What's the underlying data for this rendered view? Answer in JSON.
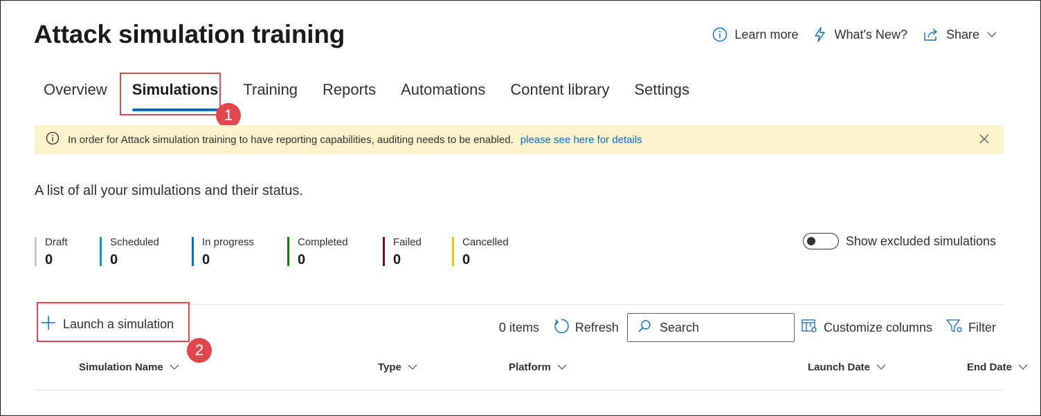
{
  "page": {
    "title": "Attack simulation training"
  },
  "header_actions": {
    "learn_more": "Learn more",
    "whats_new": "What's New?",
    "share": "Share"
  },
  "tabs": [
    {
      "label": "Overview",
      "active": false
    },
    {
      "label": "Simulations",
      "active": true
    },
    {
      "label": "Training",
      "active": false
    },
    {
      "label": "Reports",
      "active": false
    },
    {
      "label": "Automations",
      "active": false
    },
    {
      "label": "Content library",
      "active": false
    },
    {
      "label": "Settings",
      "active": false
    }
  ],
  "annotations": {
    "step1": "1",
    "step2": "2",
    "color": "#e0474c"
  },
  "banner": {
    "message": "In order for Attack simulation training to have reporting capabilities, auditing needs to be enabled.",
    "link": "please see here for details",
    "background": "#fcf2cc"
  },
  "description": "A list of all your simulations and their status.",
  "stats": [
    {
      "label": "Draft",
      "value": "0",
      "color": "#c8c6c4"
    },
    {
      "label": "Scheduled",
      "value": "0",
      "color": "#00a2ad"
    },
    {
      "label": "In progress",
      "value": "0",
      "color": "#0f6cbd"
    },
    {
      "label": "Completed",
      "value": "0",
      "color": "#107c10"
    },
    {
      "label": "Failed",
      "value": "0",
      "color": "#750b1c"
    },
    {
      "label": "Cancelled",
      "value": "0",
      "color": "#ffb900"
    }
  ],
  "toggle": {
    "label": "Show excluded simulations",
    "on": false
  },
  "commands": {
    "launch": "Launch a simulation",
    "items_count": "0 items",
    "refresh": "Refresh",
    "search_placeholder": "Search",
    "customize_columns": "Customize columns",
    "filter": "Filter"
  },
  "table": {
    "columns": [
      "Simulation Name",
      "Type",
      "Platform",
      "Launch Date",
      "End Date"
    ]
  },
  "colors": {
    "accent": "#0f6cbd"
  }
}
